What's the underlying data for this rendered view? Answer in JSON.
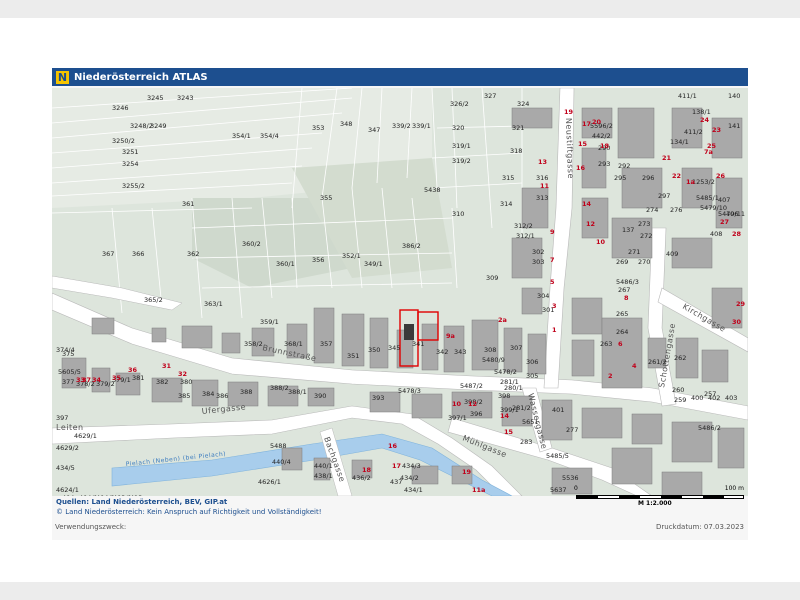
{
  "header": {
    "logo_letter": "N",
    "title": "Niederösterreich ATLAS"
  },
  "streets": {
    "brunnstrasse": "Brunnstraße",
    "ufergasse": "Ufergasse",
    "muehlgasse": "Mühlgasse",
    "neustiftgasse": "Neustiftgasse",
    "schottengasse": "Schottengasse",
    "kirchgasse": "Kirchgasse",
    "wassergasse": "Wassergasse",
    "leiten": "Leiten",
    "bachgasse": "Bachgasse",
    "stream": "Pielach (Neben) (bei Pielach)"
  },
  "parcels": [
    "3245",
    "3243",
    "3246",
    "3248/2",
    "3249",
    "3250/2",
    "3251",
    "3254",
    "3255/2",
    "354/1",
    "354/4",
    "353",
    "348",
    "347",
    "339/2",
    "339/1",
    "327",
    "326/2",
    "324",
    "320",
    "321",
    "319/1",
    "319/2",
    "318",
    "315",
    "316",
    "313",
    "314",
    "310",
    "312/2",
    "312/1",
    "302",
    "303",
    "309",
    "304",
    "301",
    "355",
    "361",
    "360/2",
    "360/1",
    "356",
    "352/1",
    "349/1",
    "386/2",
    "5438",
    "367",
    "366",
    "362",
    "365/2",
    "363/1",
    "358/2",
    "359/1",
    "368/1",
    "357",
    "351",
    "350",
    "345",
    "341",
    "342",
    "343",
    "308",
    "307",
    "306",
    "305",
    "375",
    "374/4",
    "5605/5",
    "377",
    "378/2",
    "379/2",
    "379/1",
    "381",
    "382",
    "380",
    "385",
    "384",
    "386",
    "388",
    "388/2",
    "388/1",
    "390",
    "393",
    "5478/3",
    "5487/2",
    "398",
    "399/1",
    "396",
    "397/1",
    "398/2",
    "397",
    "5488",
    "440/4",
    "440/1",
    "438/1",
    "436/2",
    "437",
    "434/3",
    "434/2",
    "434/1",
    "434/5",
    "4624/1",
    "4629/2",
    "4629/1",
    "4626/1",
    "5596/2",
    "442/2",
    "290",
    "293",
    "292",
    "295",
    "296",
    "297",
    "276",
    "274",
    "273",
    "272",
    "271",
    "270",
    "269",
    "267",
    "265",
    "264",
    "263",
    "262",
    "261/2",
    "260",
    "259",
    "257",
    "5486/2",
    "1253/2",
    "5485/1",
    "5479/10",
    "5479/11",
    "406",
    "407",
    "408",
    "409",
    "411/1",
    "411/2",
    "138/1",
    "140",
    "141",
    "134/1",
    "137",
    "5486/3",
    "5480/9",
    "5478/2",
    "281/1",
    "280/1",
    "281/2",
    "5651",
    "283",
    "5485/5",
    "277",
    "5536",
    "5637",
    "401",
    "400",
    "402",
    "403",
    "404",
    "404/1",
    "404/2",
    "403/1",
    "413"
  ],
  "house_numbers": [
    "19",
    "17",
    "15",
    "13",
    "11",
    "9",
    "7",
    "5",
    "3",
    "1",
    "20",
    "18",
    "16",
    "14",
    "12",
    "10",
    "8",
    "6",
    "4",
    "2",
    "21",
    "22",
    "23",
    "24",
    "25",
    "26",
    "27",
    "28",
    "29",
    "30",
    "31",
    "32",
    "33",
    "34",
    "35",
    "36",
    "37",
    "7a",
    "11a",
    "1a",
    "2a",
    "9a",
    "10",
    "12",
    "14",
    "15",
    "16",
    "17",
    "18",
    "19"
  ],
  "footer": {
    "source": "Quellen: Land Niederösterreich, BEV, GIP.at",
    "copyright": "© Land Niederösterreich: Kein Anspruch auf Richtigkeit und Vollständigkeit!",
    "purpose": "Verwendungszweck:",
    "print_date": "Druckdatum: 07.03.2023",
    "scale_start": "0",
    "scale_end": "100 m",
    "scale_ratio": "M 1:2.000"
  },
  "colors": {
    "header": "#1d4f8f",
    "building": "#a9a9a9",
    "road": "#ffffff",
    "water": "#a8cdec",
    "green": "#d7e1d6",
    "highlight": "#e00000"
  }
}
